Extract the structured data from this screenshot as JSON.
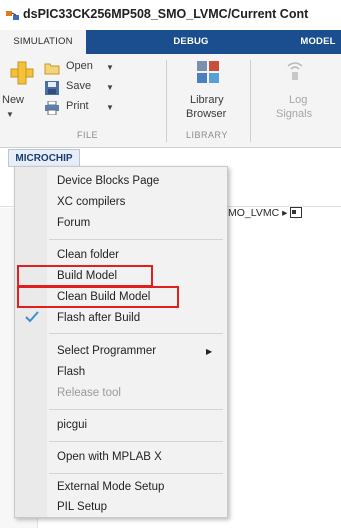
{
  "window": {
    "title": "dsPIC33CK256MP508_SMO_LVMC/Current Cont"
  },
  "ribbon_tabs": [
    {
      "label": "SIMULATION",
      "active": true
    },
    {
      "label": "DEBUG",
      "active": false
    },
    {
      "label": "MODEL",
      "active": false
    }
  ],
  "file_group": {
    "new_label": "New",
    "open_label": "Open",
    "save_label": "Save",
    "print_label": "Print",
    "group_label": "FILE"
  },
  "library_group": {
    "button_line1": "Library",
    "button_line2": "Browser",
    "group_label": "LIBRARY"
  },
  "log_group": {
    "button_line1": "Log",
    "button_line2": "Signals"
  },
  "microchip_tab": {
    "label": "MICROCHIP"
  },
  "background": {
    "breadcrumb": "MO_LVMC ▸"
  },
  "menu": {
    "items": [
      {
        "label": "Device Blocks Page"
      },
      {
        "label": "XC compilers"
      },
      {
        "label": "Forum"
      },
      {
        "label": "Clean folder"
      },
      {
        "label": "Build Model"
      },
      {
        "label": "Clean Build Model"
      },
      {
        "label": "Flash after Build",
        "checked": true
      },
      {
        "label": "Select Programmer",
        "has_submenu": true
      },
      {
        "label": "Flash"
      },
      {
        "label": "Release tool",
        "disabled": true
      },
      {
        "label": "picgui"
      },
      {
        "label": "Open with MPLAB X"
      },
      {
        "label": "External Mode Setup"
      },
      {
        "label": "PIL Setup"
      }
    ]
  },
  "colors": {
    "tab_strip": "#1a4e8e",
    "highlight_box": "#e02020",
    "check": "#3b8fd6"
  }
}
